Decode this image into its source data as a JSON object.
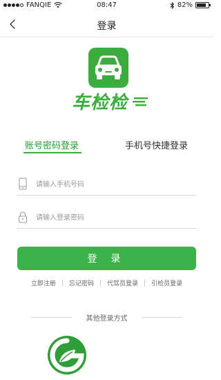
{
  "status_bar": {
    "carrier": "FANQIE",
    "time": "08:47",
    "battery": "82%",
    "battery_level": 0.82
  },
  "nav": {
    "title": "登录",
    "back_icon": "chevron-left-icon"
  },
  "logo": {
    "app_name": "车检检"
  },
  "tabs": [
    {
      "label": "账号密码登录",
      "active": true
    },
    {
      "label": "手机号快捷登录",
      "active": false
    }
  ],
  "form": {
    "phone_placeholder": "请输入手机号码",
    "password_placeholder": "请输入登录密码",
    "login_label": "登 录"
  },
  "links": [
    "立即注册",
    "忘记密码",
    "代驾员登录",
    "引检员登录"
  ],
  "other_login": {
    "label": "其他登录方式"
  },
  "colors": {
    "accent": "#3cac3e",
    "button": "#3cb34a"
  }
}
